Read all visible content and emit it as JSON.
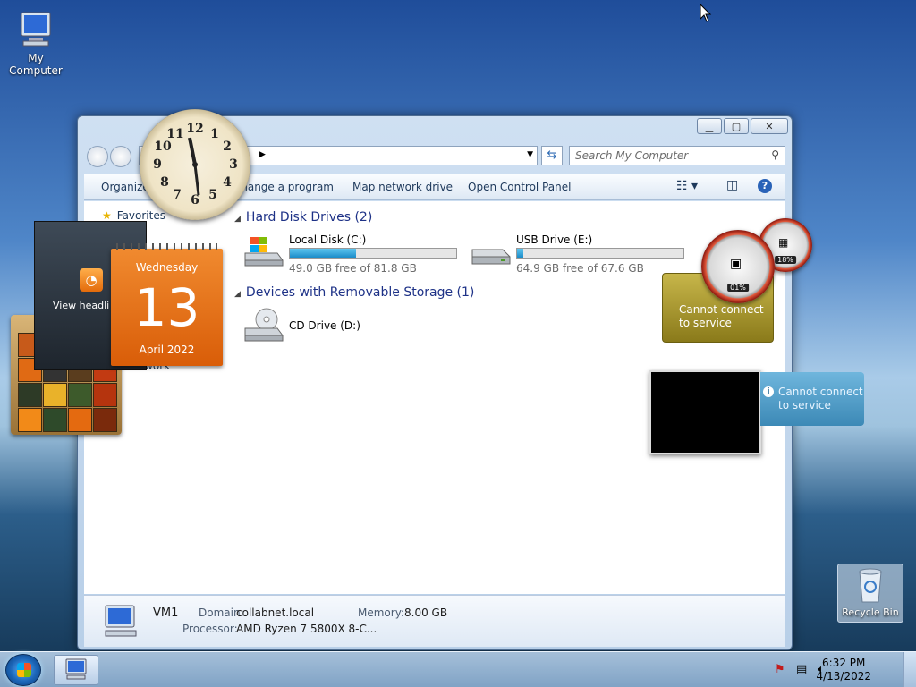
{
  "desktop": {
    "my_computer_label": "My Computer",
    "recycle_bin_label": "Recycle Bin"
  },
  "window": {
    "search_placeholder": "Search My Computer",
    "toolbar": {
      "organize": "Organize",
      "uninstall": "Uninstall or change a program",
      "map_drive": "Map network drive",
      "control_panel": "Open Control Panel"
    },
    "nav": {
      "favorites": "Favorites",
      "network": "Network"
    },
    "groups": {
      "hard_disks": "Hard Disk Drives (2)",
      "removable": "Devices with Removable Storage (1)"
    },
    "drives": [
      {
        "name": "Local Disk (C:)",
        "free": "49.0 GB free of 81.8 GB",
        "used_fraction": 0.4
      },
      {
        "name": "USB Drive (E:)",
        "free": "64.9 GB free of 67.6 GB",
        "used_fraction": 0.04
      }
    ],
    "cd_drive": "CD Drive (D:)",
    "details": {
      "name": "VM1",
      "domain_label": "Domain:",
      "domain_value": "collabnet.local",
      "memory_label": "Memory:",
      "memory_value": "8.00 GB",
      "processor_label": "Processor:",
      "processor_value": "AMD Ryzen 7 5800X 8-C..."
    }
  },
  "gadgets": {
    "rss_label": "View headli",
    "calendar": {
      "weekday": "Wednesday",
      "day": "13",
      "month_year": "April 2022"
    },
    "cpu_meter": {
      "cpu": "01%",
      "memory": "18%"
    },
    "weather_text_1": "Cannot connect",
    "weather_text_2": "to service",
    "slideshow_text_1": "Cannot connect",
    "slideshow_text_2": "to service",
    "clock_numbers": [
      "12",
      "1",
      "2",
      "3",
      "4",
      "5",
      "6",
      "7",
      "8",
      "9",
      "10",
      "11"
    ]
  },
  "taskbar": {
    "time": "6:32 PM",
    "date": "4/13/2022"
  },
  "colors": {
    "accent": "#1b8cc8",
    "calendar": "#e36b0b"
  }
}
